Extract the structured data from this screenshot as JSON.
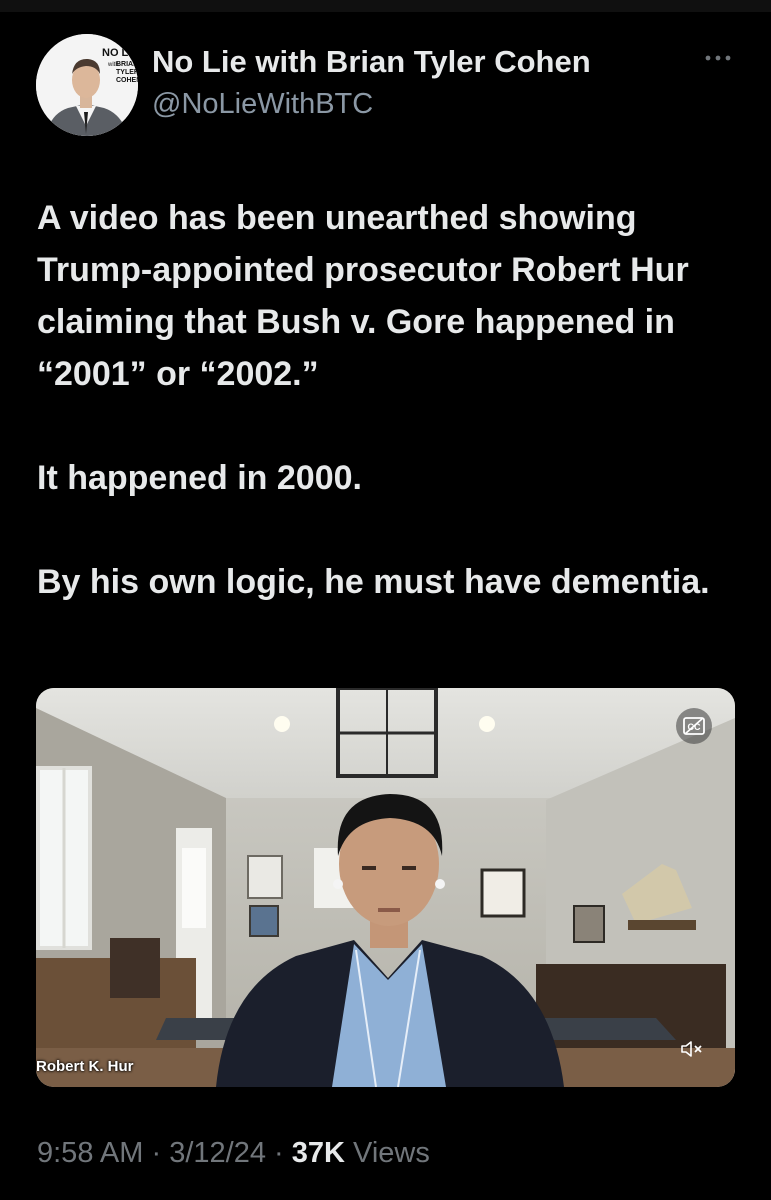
{
  "author": {
    "name": "No Lie with Brian Tyler Cohen",
    "handle": "@NoLieWithBTC",
    "avatar_logo_text": "NO LIE with BRIAN TYLER COHEN"
  },
  "more_icon": "more-horizontal-icon",
  "tweet": {
    "paragraphs": [
      "A video has been unearthed showing Trump-appointed prosecutor Robert Hur claiming that Bush v. Gore happened in “2001” or “2002.”",
      "It happened in 2000.",
      "By his own logic, he must have dementia."
    ]
  },
  "media": {
    "speaker_label": "Robert K. Hur",
    "cc_icon": "closed-captions-icon",
    "mute_icon": "speaker-muted-icon"
  },
  "meta": {
    "time": "9:58 AM",
    "separator": "·",
    "date": "3/12/24",
    "views_count": "37K",
    "views_label": "Views"
  },
  "colors": {
    "background": "#000000",
    "text_primary": "#e7e9ea",
    "text_secondary": "#71767b"
  }
}
